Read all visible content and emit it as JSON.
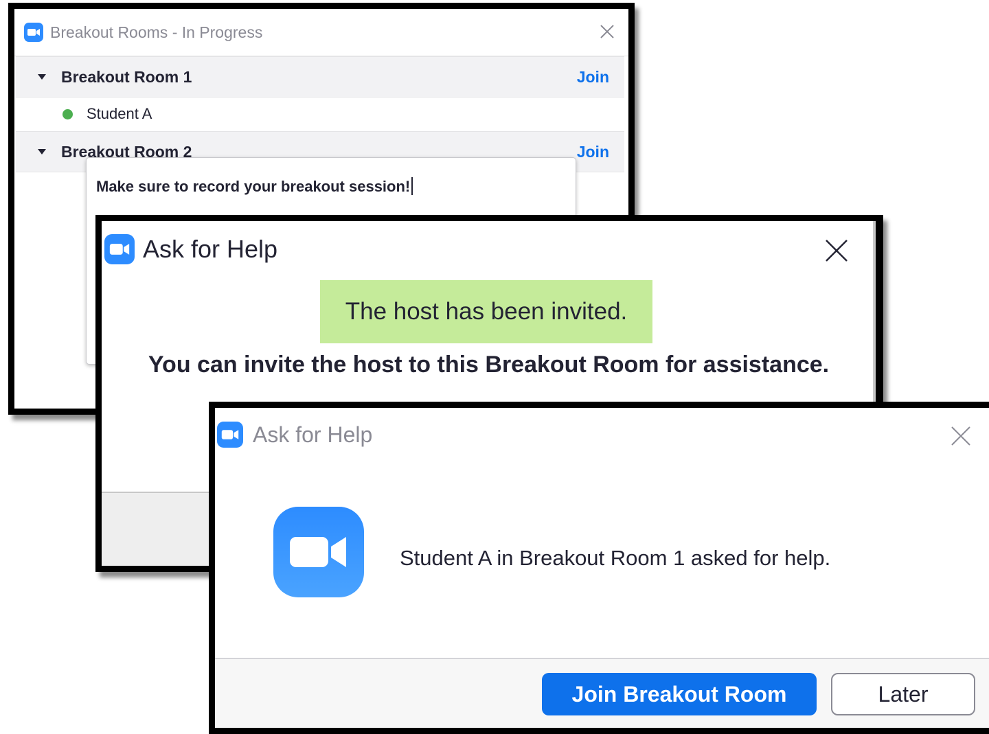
{
  "breakout_window": {
    "title": "Breakout Rooms - In Progress",
    "rooms": [
      {
        "name": "Breakout Room 1",
        "join_label": "Join",
        "members": [
          "Student A"
        ]
      },
      {
        "name": "Breakout Room 2",
        "join_label": "Join",
        "members": []
      }
    ],
    "broadcast_message": "Make sure to record your breakout session!"
  },
  "invited_dialog": {
    "title": "Ask for Help",
    "notice": "The host has been invited.",
    "info": "You can invite the host to this Breakout Room for assistance."
  },
  "help_request_dialog": {
    "title": "Ask for Help",
    "message": "Student A in Breakout Room 1 asked for help.",
    "join_button": "Join Breakout Room",
    "later_button": "Later"
  },
  "colors": {
    "accent": "#0e71eb",
    "notice_bg": "#c5eb9a",
    "status_online": "#4caf50"
  },
  "icons": [
    "zoom-logo-icon",
    "close-icon",
    "caret-down-icon",
    "online-dot-icon",
    "zoom-camera-icon"
  ]
}
